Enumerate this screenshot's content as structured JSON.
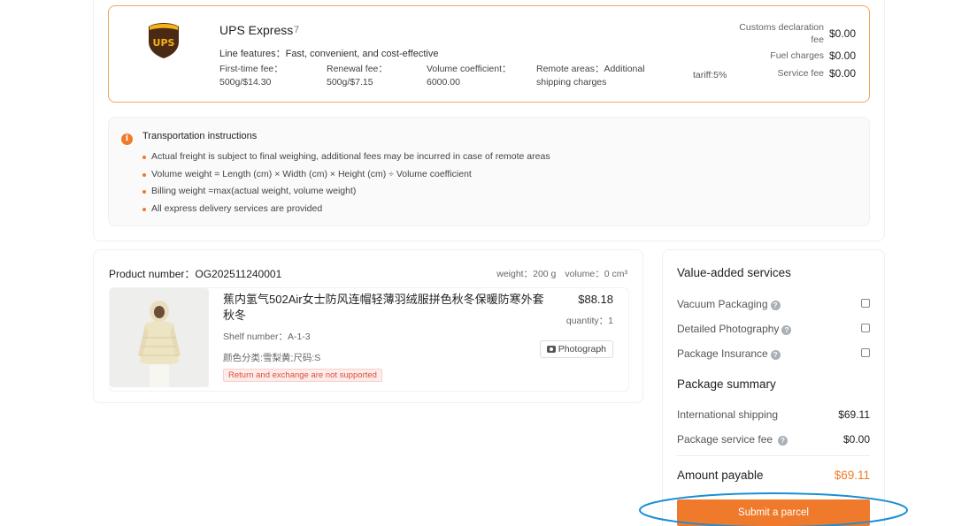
{
  "shipping": {
    "name": "UPS Express",
    "number": "7",
    "logo_text": "UPS",
    "features": "Line features：Fast, convenient, and cost-effective",
    "first_fee_label": "First-time fee：",
    "first_fee_value": "500g/$14.30",
    "renewal_fee_label": "Renewal fee：",
    "renewal_fee_value": "500g/$7.15",
    "volume_label": "Volume coefficient：",
    "volume_value": "6000.00",
    "remote_line1": "Remote areas：Additional",
    "remote_line2": "shipping charges",
    "tariff": "tariff:5%",
    "customs_label": "Customs declaration fee",
    "customs_value": "$0.00",
    "fuel_label": "Fuel charges",
    "fuel_value": "$0.00",
    "service_label": "Service fee",
    "service_value": "$0.00"
  },
  "instructions": {
    "icon": "i",
    "title": "Transportation instructions",
    "items": [
      "Actual freight is subject to final weighing, additional fees may be incurred in case of remote areas",
      "Volume weight = Length (cm) × Width (cm) × Height (cm) ÷ Volume coefficient",
      "Billing weight =max(actual weight, volume weight)",
      "All express delivery services are provided"
    ]
  },
  "product": {
    "number": "Product number：OG202511240001",
    "weight": "weight：200 g",
    "volume": "volume：0 cm³",
    "title": "蕉内氢气502Air女士防风连帽轻薄羽绒服拼色秋冬保暖防寒外套秋冬",
    "price": "$88.18",
    "quantity": "quantity：1",
    "shelf": "Shelf number：A-1-3",
    "attributes": "颜色分类:雪梨黄;尺码:S",
    "tag": "Return and exchange are not supported",
    "photo_button": "Photograph"
  },
  "value_added": {
    "title": "Value-added services",
    "options": [
      {
        "label": "Vacuum Packaging",
        "checked": false
      },
      {
        "label": "Detailed Photography",
        "checked": false
      },
      {
        "label": "Package Insurance",
        "checked": false
      }
    ]
  },
  "summary": {
    "title": "Package summary",
    "intl_label": "International shipping",
    "intl_value": "$69.11",
    "service_label": "Package service fee",
    "service_value": "$0.00",
    "payable_label": "Amount payable",
    "payable_value": "$69.11",
    "submit": "Submit a parcel"
  },
  "colors": {
    "accent": "#f07a2b",
    "annotation": "#1a8fd6"
  }
}
